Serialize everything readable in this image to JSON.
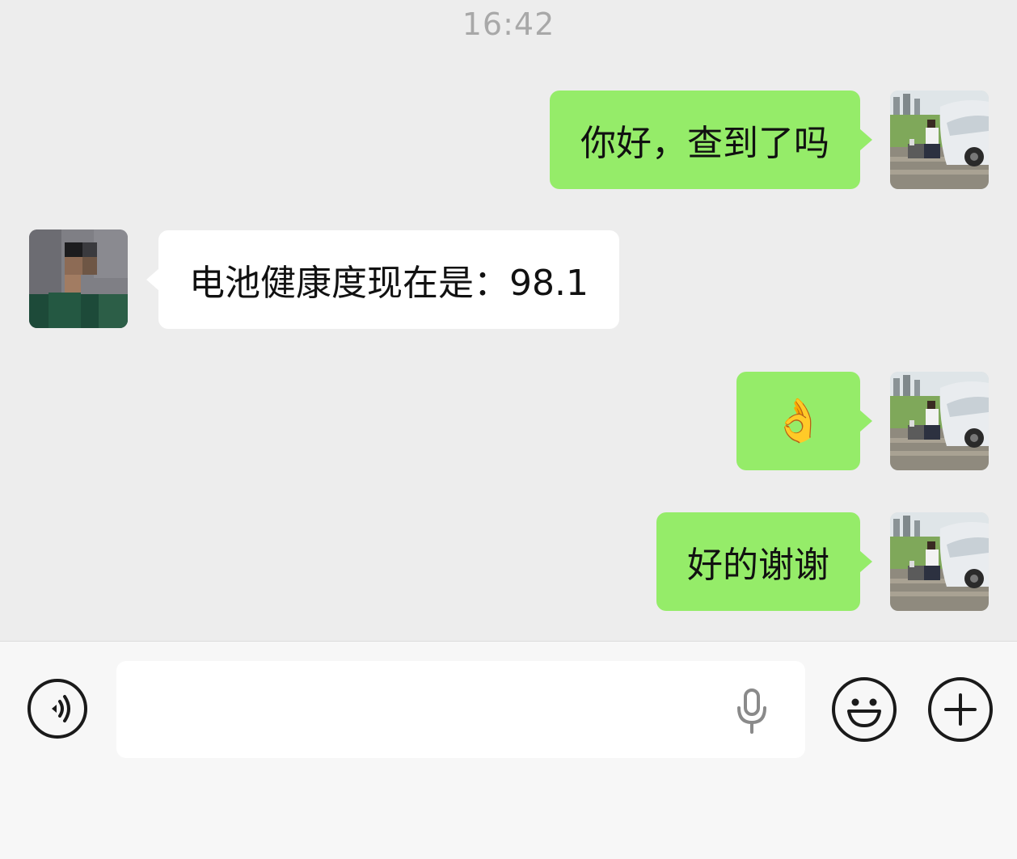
{
  "chat": {
    "timestamp": "16:42",
    "messages": [
      {
        "sender": "me",
        "text": "你好，查到了吗"
      },
      {
        "sender": "other",
        "text": "电池健康度现在是：98.1"
      },
      {
        "sender": "me",
        "text": "👌"
      },
      {
        "sender": "me",
        "text": "好的谢谢"
      }
    ]
  },
  "input_bar": {
    "input_value": "",
    "icons": {
      "voice": "voice-mode-icon",
      "mic": "microphone-icon",
      "emoji": "emoji-icon",
      "plus": "plus-icon"
    }
  },
  "colors": {
    "background": "#ededed",
    "my_bubble": "#95ec69",
    "other_bubble": "#ffffff",
    "timestamp": "#a8a8a8",
    "input_bar": "#f7f7f7"
  }
}
